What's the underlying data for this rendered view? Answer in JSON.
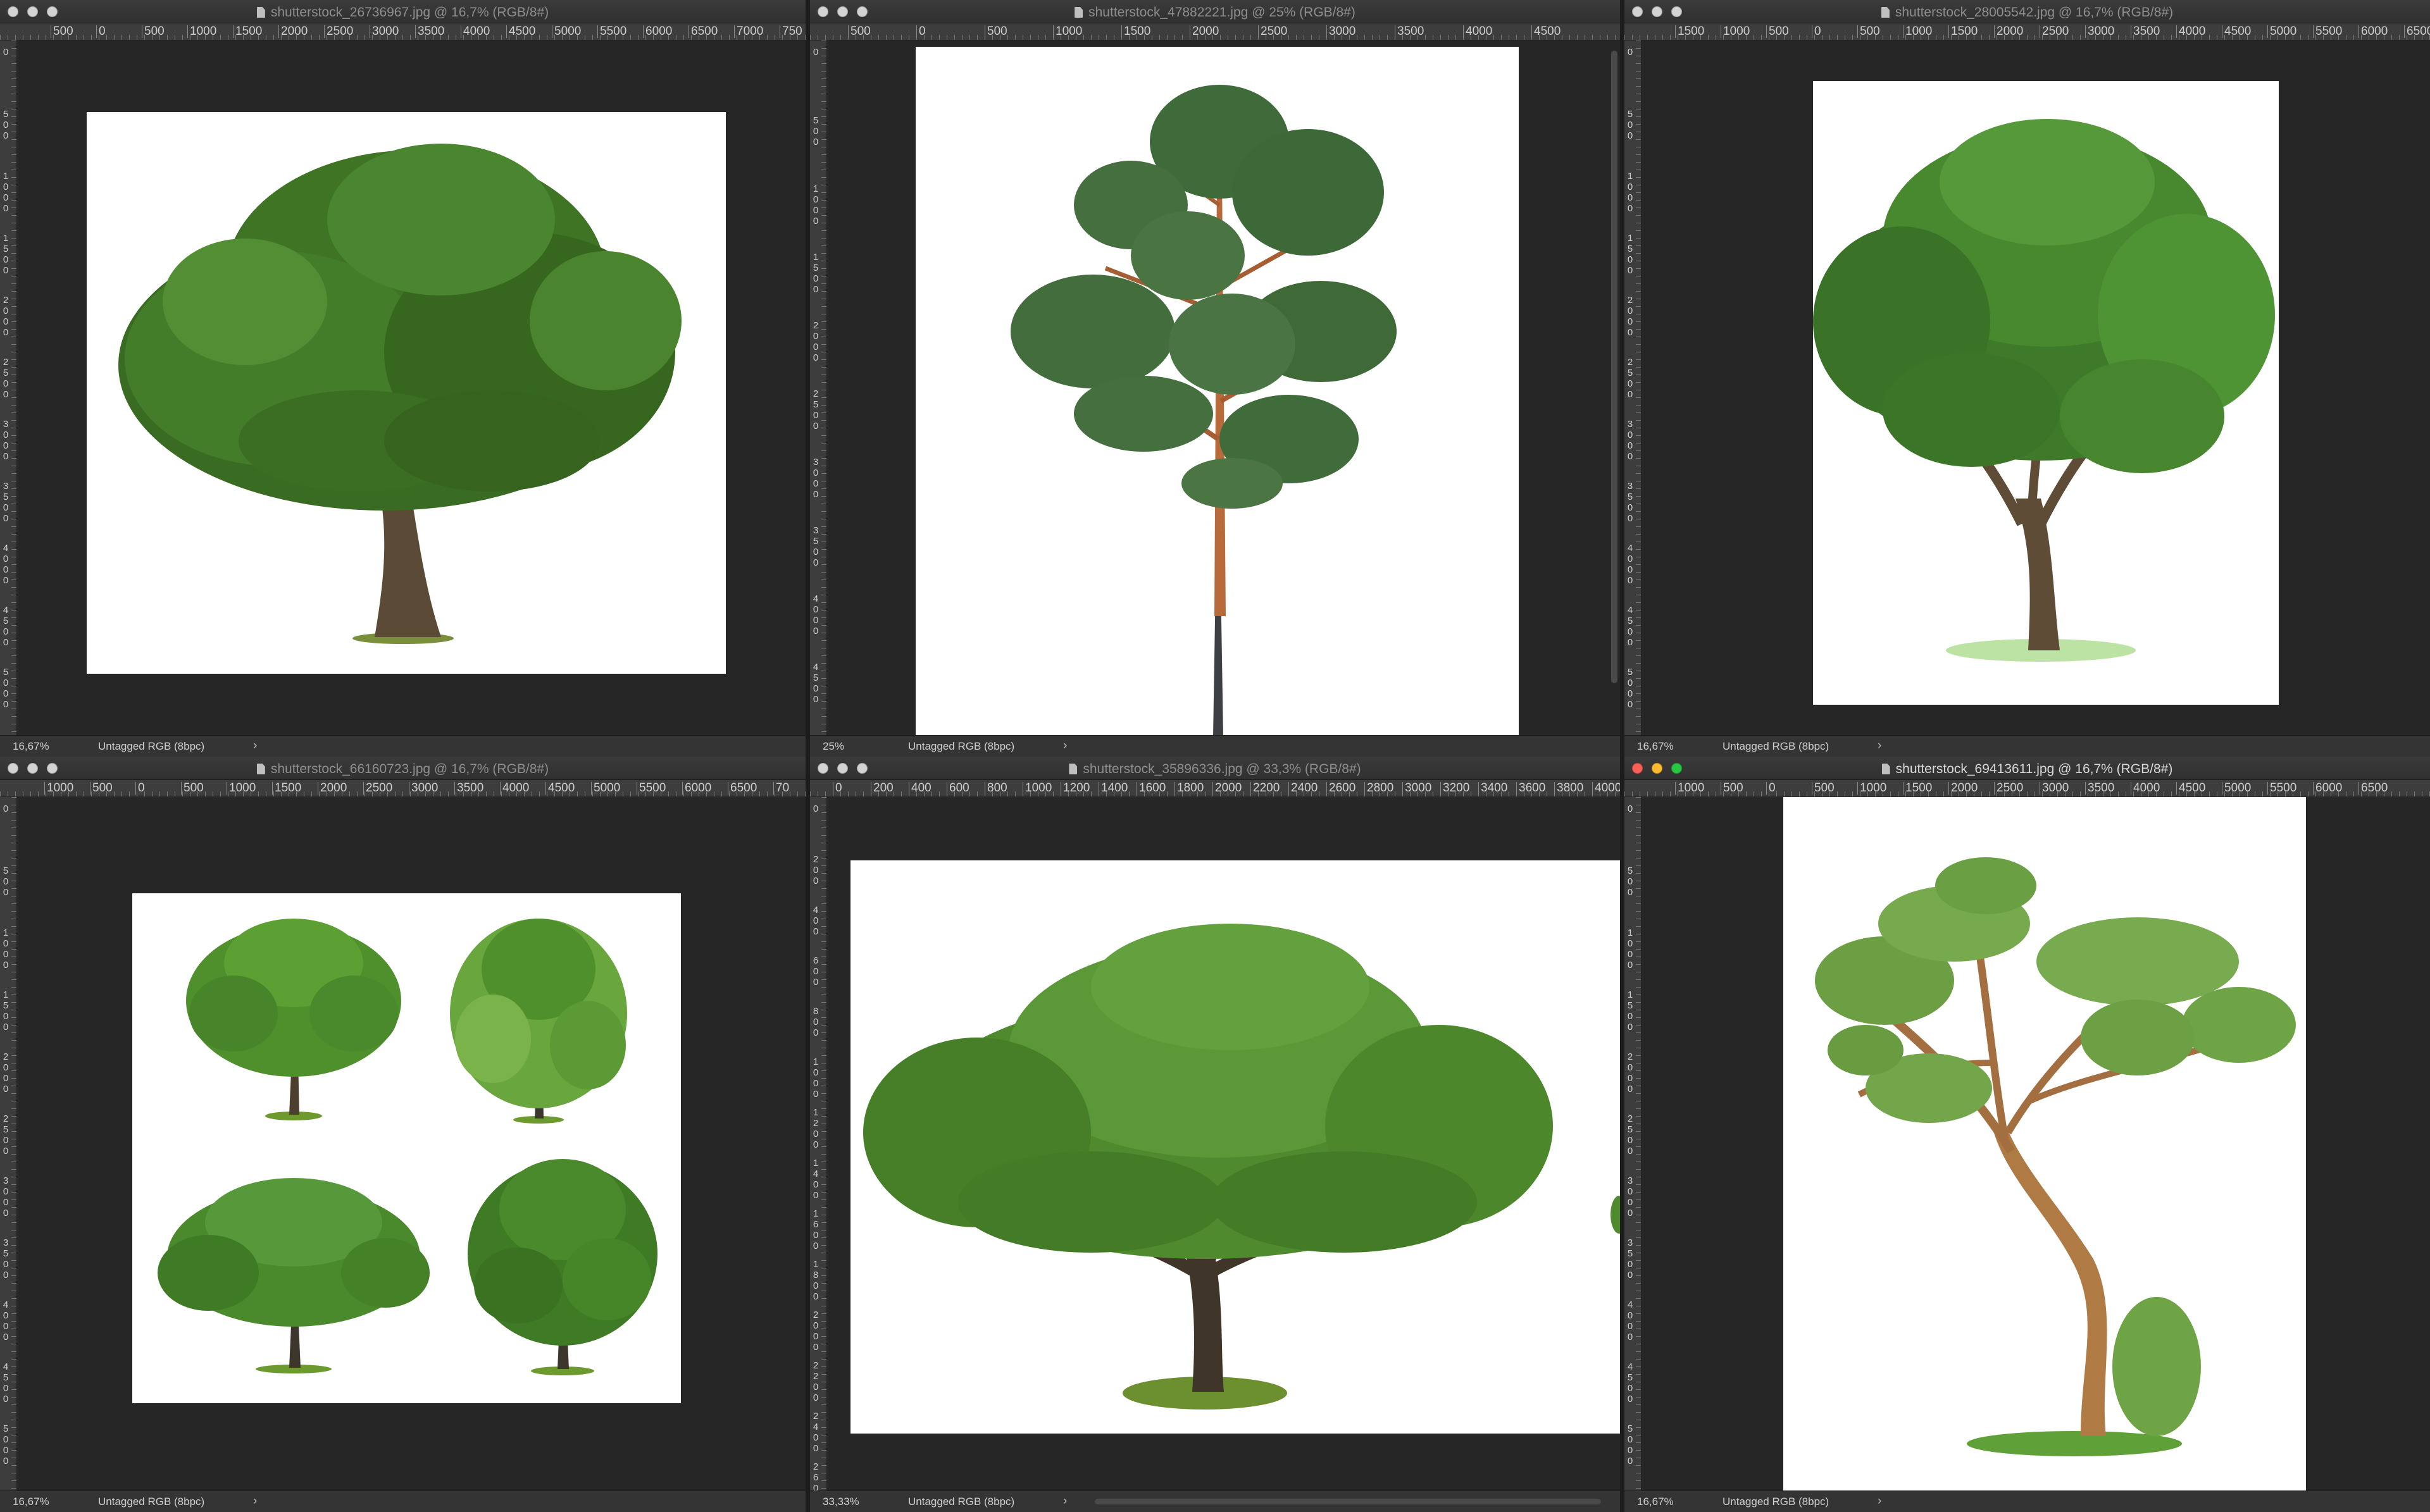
{
  "windows": [
    {
      "title": "shutterstock_26736967.jpg @ 16,7% (RGB/8#)",
      "zoom": "16,67%",
      "profile": "Untagged RGB (8bpc)",
      "ruler_h": [
        "500",
        "0",
        "500",
        "1000",
        "1500",
        "2000",
        "2500",
        "3000",
        "3500",
        "4000",
        "4500",
        "5000",
        "5500",
        "6000",
        "6500",
        "7000",
        "750"
      ],
      "ruler_v": [
        "0",
        "500",
        "1000",
        "1500",
        "2000",
        "2500",
        "3000",
        "3500",
        "4000",
        "4500",
        "5000"
      ]
    },
    {
      "title": "shutterstock_47882221.jpg @ 25% (RGB/8#)",
      "zoom": "25%",
      "profile": "Untagged RGB (8bpc)",
      "ruler_h": [
        "500",
        "0",
        "500",
        "1000",
        "1500",
        "2000",
        "2500",
        "3000",
        "3500",
        "4000",
        "4500"
      ],
      "ruler_v": [
        "0",
        "500",
        "1000",
        "1500",
        "2000",
        "2500",
        "3000",
        "3500",
        "4000",
        "4500"
      ]
    },
    {
      "title": "shutterstock_28005542.jpg @ 16,7% (RGB/8#)",
      "zoom": "16,67%",
      "profile": "Untagged RGB (8bpc)",
      "ruler_h": [
        "1500",
        "1000",
        "500",
        "0",
        "500",
        "1000",
        "1500",
        "2000",
        "2500",
        "3000",
        "3500",
        "4000",
        "4500",
        "5000",
        "5500",
        "6000",
        "6500"
      ],
      "ruler_v": [
        "0",
        "500",
        "1000",
        "1500",
        "2000",
        "2500",
        "3000",
        "3500",
        "4000",
        "4500",
        "5000"
      ]
    },
    {
      "title": "shutterstock_66160723.jpg @ 16,7% (RGB/8#)",
      "zoom": "16,67%",
      "profile": "Untagged RGB (8bpc)",
      "ruler_h": [
        "1000",
        "500",
        "0",
        "500",
        "1000",
        "1500",
        "2000",
        "2500",
        "3000",
        "3500",
        "4000",
        "4500",
        "5000",
        "5500",
        "6000",
        "6500",
        "70"
      ],
      "ruler_v": [
        "0",
        "500",
        "1000",
        "1500",
        "2000",
        "2500",
        "3000",
        "3500",
        "4000",
        "4500",
        "5000"
      ]
    },
    {
      "title": "shutterstock_35896336.jpg @ 33,3% (RGB/8#)",
      "zoom": "33,33%",
      "profile": "Untagged RGB (8bpc)",
      "ruler_h": [
        "0",
        "200",
        "400",
        "600",
        "800",
        "1000",
        "1200",
        "1400",
        "1600",
        "1800",
        "2000",
        "2200",
        "2400",
        "2600",
        "2800",
        "3000",
        "3200",
        "3400",
        "3600",
        "3800",
        "4000"
      ],
      "ruler_v": [
        "0",
        "200",
        "400",
        "600",
        "800",
        "1000",
        "1200",
        "1400",
        "1600",
        "1800",
        "2000",
        "2200",
        "2400",
        "2600"
      ]
    },
    {
      "title": "shutterstock_69413611.jpg @ 16,7% (RGB/8#)",
      "zoom": "16,67%",
      "profile": "Untagged RGB (8bpc)",
      "ruler_h": [
        "1000",
        "500",
        "0",
        "500",
        "1000",
        "1500",
        "2000",
        "2500",
        "3000",
        "3500",
        "4000",
        "4500",
        "5000",
        "5500",
        "6000",
        "6500"
      ],
      "ruler_v": [
        "0",
        "500",
        "1000",
        "1500",
        "2000",
        "2500",
        "3000",
        "3500",
        "4000",
        "4500",
        "5000"
      ]
    }
  ],
  "status_arrow": "›",
  "colors": {
    "workspace": "#262626",
    "titlebar": "#323232",
    "ruler": "#3d3d3d",
    "close": "#fe5f57",
    "minimize": "#febc2e",
    "maximize": "#28c840"
  }
}
